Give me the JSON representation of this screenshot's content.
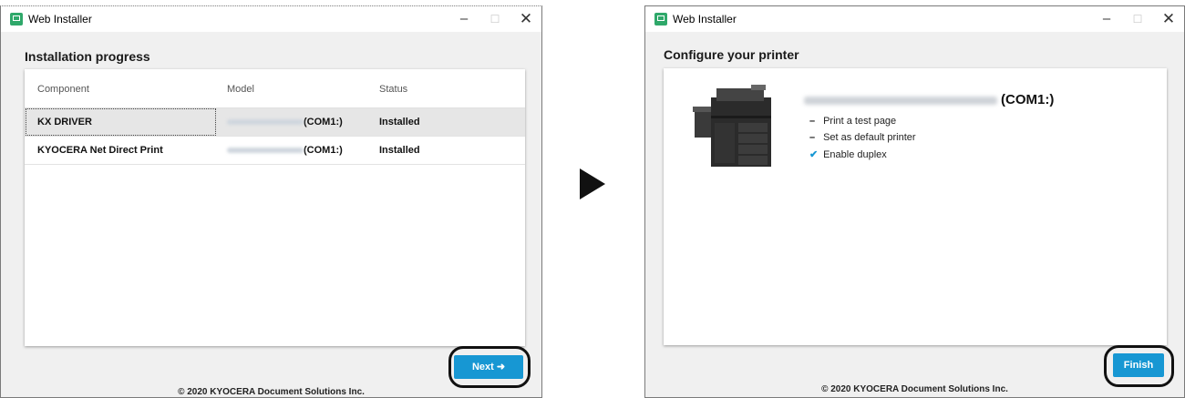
{
  "window1": {
    "title": "Web Installer",
    "heading": "Installation progress",
    "columns": [
      "Component",
      "Model",
      "Status"
    ],
    "rows": [
      {
        "component": "KX DRIVER",
        "model_suffix": "(COM1:)",
        "status": "Installed"
      },
      {
        "component": "KYOCERA Net Direct Print",
        "model_suffix": "(COM1:)",
        "status": "Installed"
      }
    ],
    "next_label": "Next",
    "next_icon": "arrow-right-icon",
    "footer": "© 2020 KYOCERA Document Solutions Inc."
  },
  "window2": {
    "title": "Web Installer",
    "heading": "Configure your printer",
    "printer_name_suffix": "(COM1:)",
    "options": [
      {
        "label": "Print a test page",
        "checked": false
      },
      {
        "label": "Set as default printer",
        "checked": false
      },
      {
        "label": "Enable duplex",
        "checked": true
      }
    ],
    "finish_label": "Finish",
    "footer": "© 2020 KYOCERA Document Solutions Inc."
  },
  "colors": {
    "accent": "#1797d3",
    "app_icon": "#2fa86a"
  }
}
